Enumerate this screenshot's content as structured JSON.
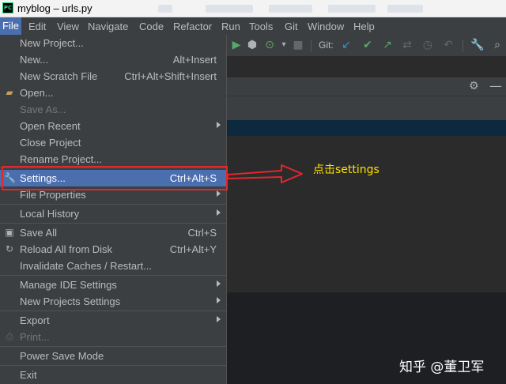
{
  "window": {
    "app_icon": "PC",
    "title": "myblog – urls.py"
  },
  "menubar": {
    "items": [
      {
        "label": "File",
        "active": true
      },
      {
        "label": "Edit"
      },
      {
        "label": "View"
      },
      {
        "label": "Navigate"
      },
      {
        "label": "Code"
      },
      {
        "label": "Refactor"
      },
      {
        "label": "Run"
      },
      {
        "label": "Tools"
      },
      {
        "label": "Git"
      },
      {
        "label": "Window"
      },
      {
        "label": "Help"
      }
    ]
  },
  "toolbar": {
    "git_label": "Git:"
  },
  "file_menu": {
    "items": [
      {
        "label": "New Project...",
        "icon": ""
      },
      {
        "label": "New...",
        "shortcut": "Alt+Insert"
      },
      {
        "label": "New Scratch File",
        "shortcut": "Ctrl+Alt+Shift+Insert"
      },
      {
        "label": "Open...",
        "icon": "folder-icon"
      },
      {
        "label": "Save As...",
        "disabled": true
      },
      {
        "label": "Open Recent",
        "submenu": true
      },
      {
        "label": "Close Project"
      },
      {
        "label": "Rename Project..."
      },
      {
        "label": "Settings...",
        "shortcut": "Ctrl+Alt+S",
        "icon": "wrench-icon",
        "highlighted": true
      },
      {
        "label": "File Properties",
        "submenu": true
      },
      {
        "label": "Local History",
        "submenu": true
      },
      {
        "label": "Save All",
        "shortcut": "Ctrl+S",
        "icon": "save-icon"
      },
      {
        "label": "Reload All from Disk",
        "shortcut": "Ctrl+Alt+Y",
        "icon": "reload-icon"
      },
      {
        "label": "Invalidate Caches / Restart..."
      },
      {
        "label": "Manage IDE Settings",
        "submenu": true
      },
      {
        "label": "New Projects Settings",
        "submenu": true
      },
      {
        "label": "Export",
        "submenu": true
      },
      {
        "label": "Print...",
        "disabled": true,
        "icon": "print-icon"
      },
      {
        "label": "Power Save Mode"
      },
      {
        "label": "Exit"
      }
    ]
  },
  "annotation": {
    "text": "点击settings",
    "color": "#ffe000",
    "box_color": "#e0282d"
  },
  "watermark": "知乎 @董卫军",
  "colors": {
    "accent": "#4b6eaf",
    "menu_bg": "#3c3f41",
    "editor_bg": "#2b2b2b"
  }
}
